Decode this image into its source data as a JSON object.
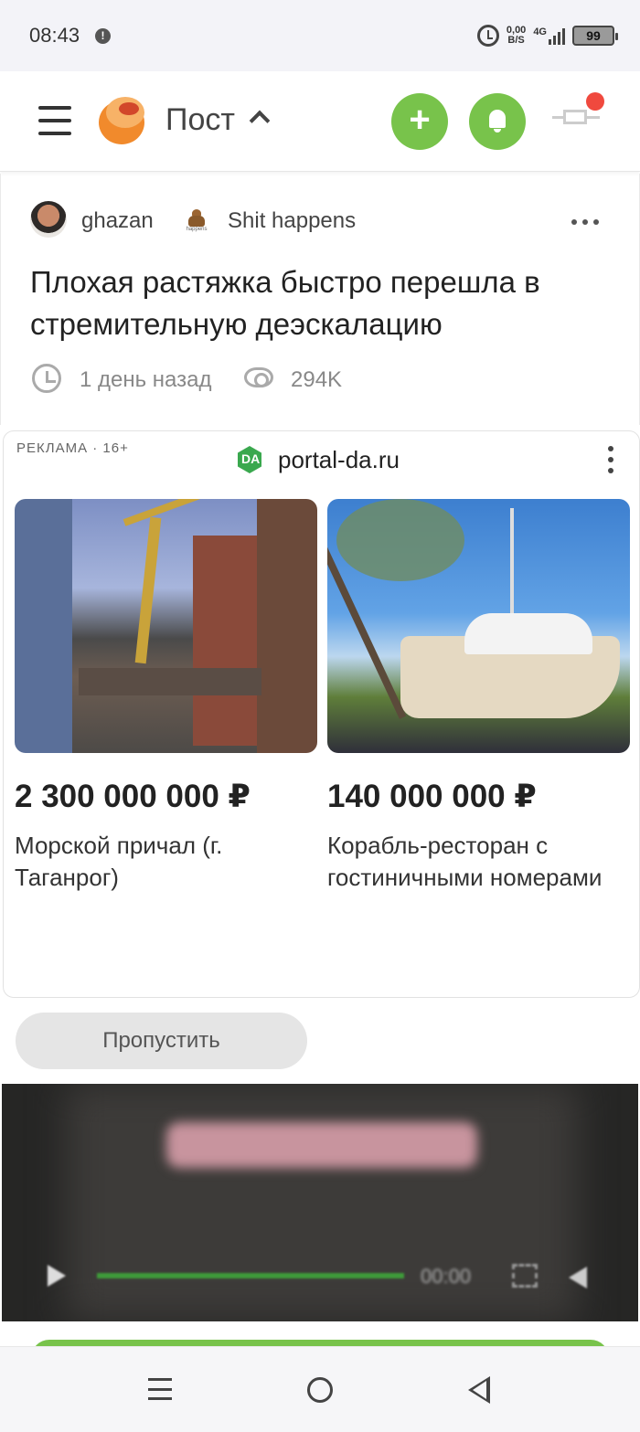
{
  "status_bar": {
    "time": "08:43",
    "alert_glyph": "!",
    "net_speed_value": "0,00",
    "net_speed_unit": "B/S",
    "network_type": "4G",
    "battery": "99",
    "icons": [
      "alert-icon",
      "alarm-icon",
      "signal-icon",
      "battery-icon"
    ]
  },
  "header": {
    "title": "Пост",
    "add_label": "+",
    "accent_color": "#78c34b",
    "notification_dot_color": "#f0493e"
  },
  "post": {
    "author": "ghazan",
    "community": "Shit happens",
    "community_icon_text": "happens",
    "title": "Плохая растяжка быстро перешла в стремительную деэскалацию",
    "time": "1 день назад",
    "views": "294K"
  },
  "ad": {
    "label": "РЕКЛАМА · 16+",
    "domain_icon_text": "DA",
    "domain": "portal-da.ru",
    "cards": [
      {
        "price": "2 300 000 000 ₽",
        "description": "Морской причал (г. Таганрог)"
      },
      {
        "price": "140 000 000 ₽",
        "description": "Корабль-ресторан с гостиничными номерами"
      }
    ],
    "skip_label": "Пропустить"
  },
  "video": {
    "time": "00:00"
  }
}
